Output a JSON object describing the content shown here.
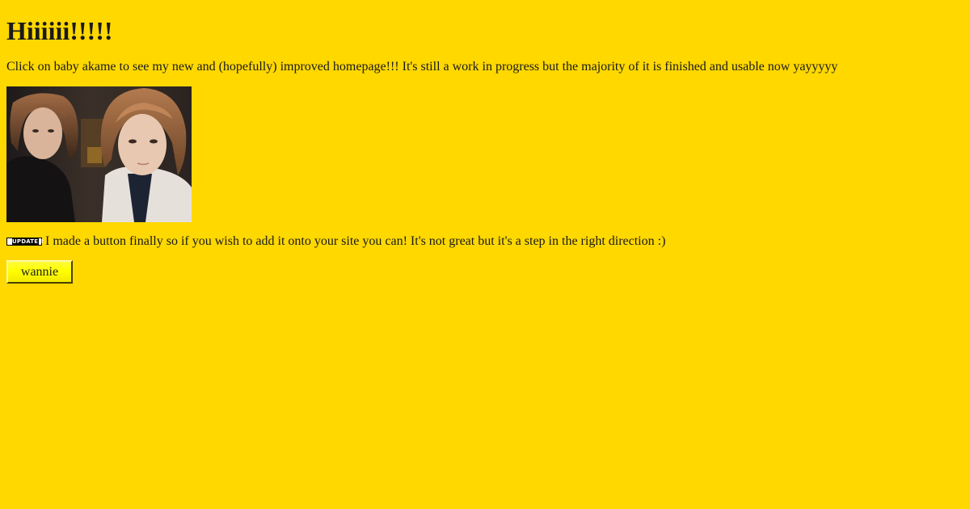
{
  "heading": "Hiiiiii!!!!!",
  "intro_text": "Click on baby akame to see my new and (hopefully) improved homepage!!! It's still a work in progress but the majority of it is finished and usable now yayyyyy",
  "photo": {
    "alt": "baby akame"
  },
  "update": {
    "badge_label": "UPDATE!!",
    "text": "I made a button finally so if you wish to add it onto your site you can! It's not great but it's a step in the right direction :)"
  },
  "site_button": {
    "label": "wannie"
  },
  "colors": {
    "background": "#ffd800",
    "button_face": "#ffff00",
    "text": "#1a1a1a"
  }
}
